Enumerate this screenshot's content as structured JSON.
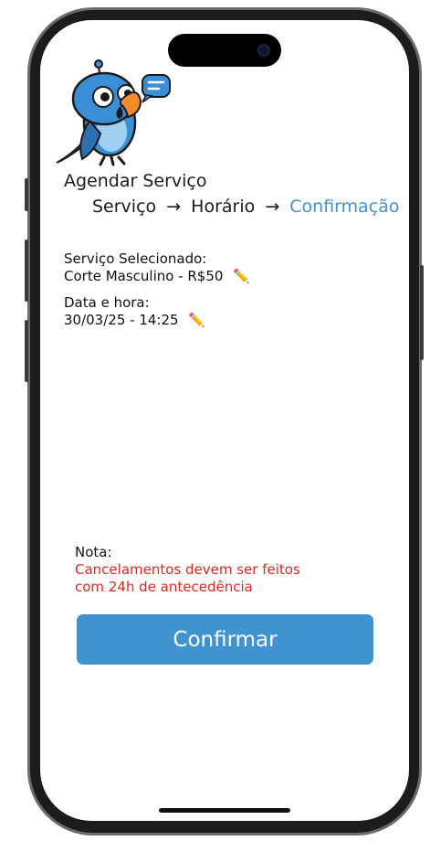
{
  "header": {
    "title": "Agendar Serviço",
    "steps": {
      "step1": "Serviço",
      "step2": "Horário",
      "step3": "Confirmação",
      "separator": "→"
    }
  },
  "summary": {
    "service_label": "Serviço Selecionado:",
    "service_value": "Corte Masculino - R$50",
    "datetime_label": "Data e hora:",
    "datetime_value": "30/03/25 - 14:25",
    "edit_icon": "pencil-icon"
  },
  "note": {
    "title": "Nota:",
    "text": "Cancelamentos devem ser feitos com 24h de antecedência"
  },
  "actions": {
    "confirm_label": "Confirmar"
  },
  "colors": {
    "accent": "#3f93cf",
    "warning": "#e0281e",
    "mascot_blue": "#3b8fd6",
    "beak": "#f28a2a"
  }
}
